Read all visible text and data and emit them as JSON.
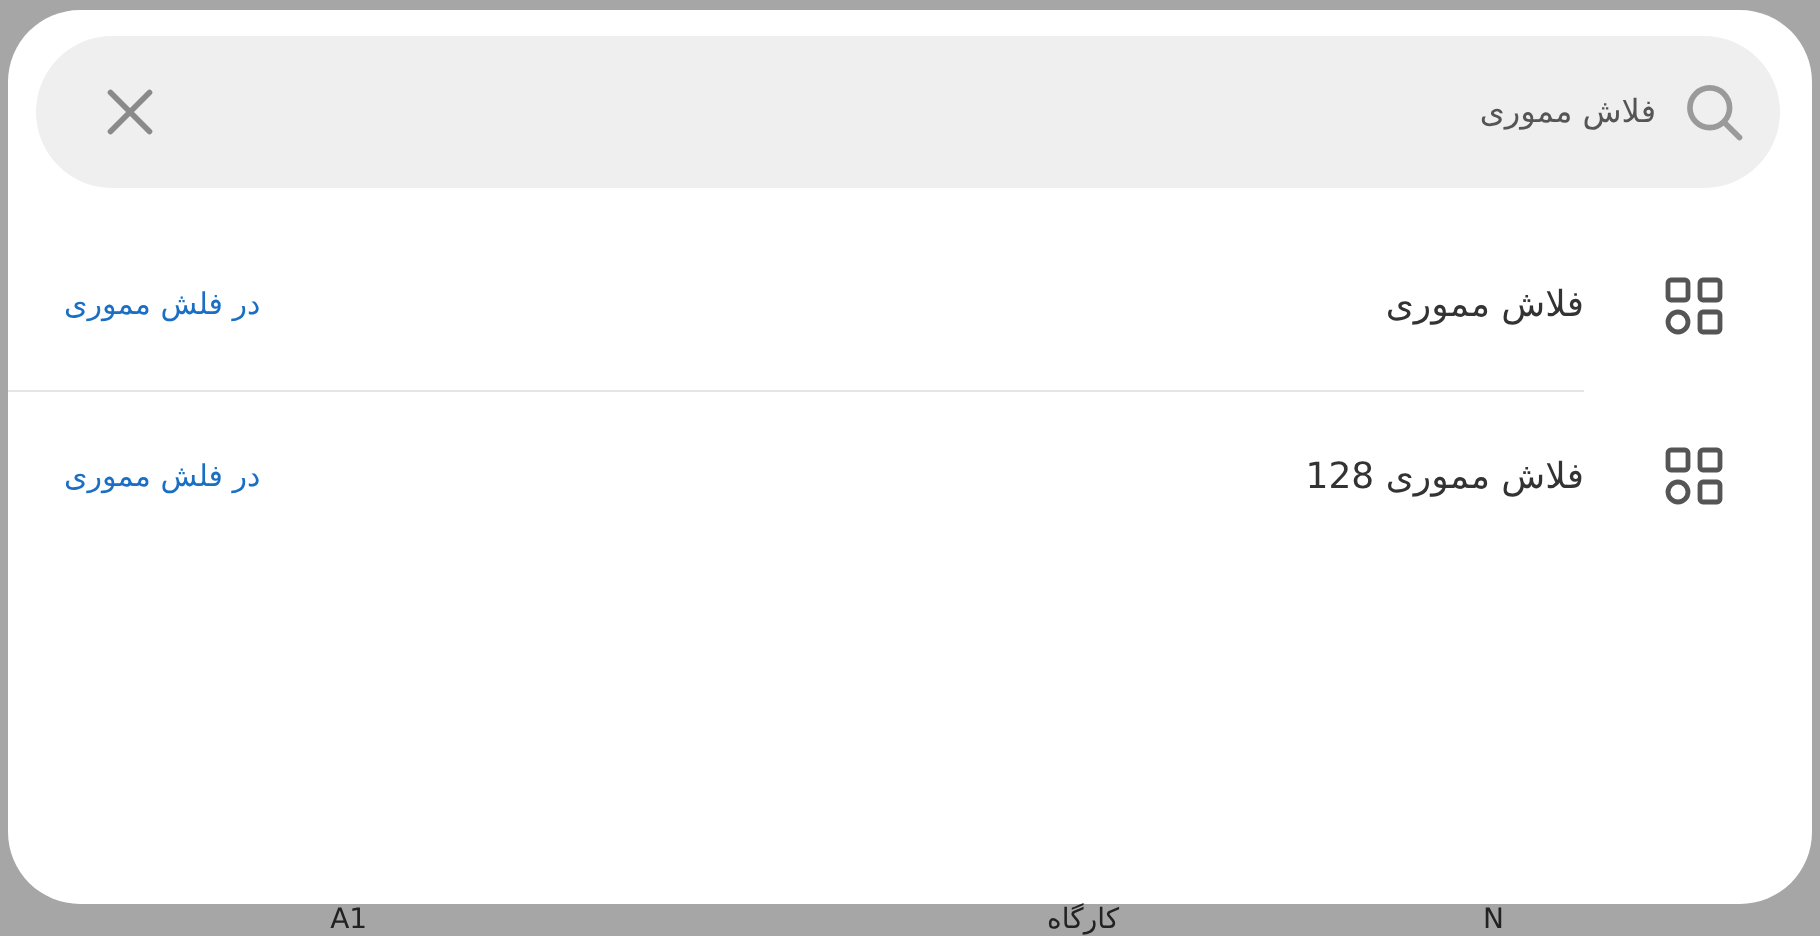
{
  "search": {
    "value": "فلاش مموری"
  },
  "results": [
    {
      "title": "فلاش مموری",
      "scope": "در فلش مموری"
    },
    {
      "title": "فلاش مموری 128",
      "scope": "در فلش مموری"
    }
  ],
  "background_labels": [
    "N",
    "کارگاه",
    "A1"
  ]
}
